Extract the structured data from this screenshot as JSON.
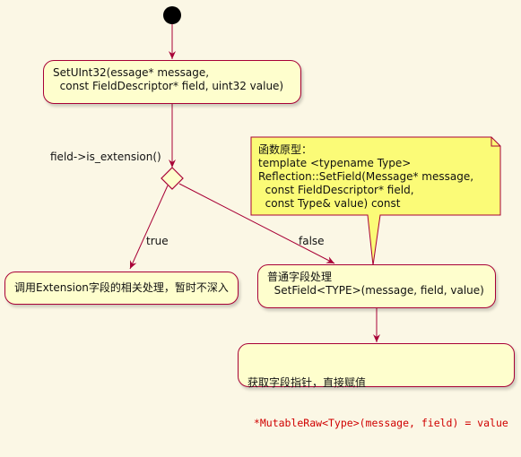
{
  "nodes": {
    "set_uint32": "SetUInt32(essage* message,\n  const FieldDescriptor* field, uint32 value)",
    "extension_process": "调用Extension字段的相关处理，暂时不深入",
    "normal_process": "普通字段处理\n  SetField<TYPE>(message, field, value)",
    "get_pointer_title": "获取字段指针，直接赋值",
    "get_pointer_code": " *MutableRaw<Type>(message, field) = value"
  },
  "decision": {
    "label": "field->is_extension()",
    "true_label": "true",
    "false_label": "false"
  },
  "note": {
    "text": "函数原型：\ntemplate <typename Type>\nReflection::SetField(Message* message,\n  const FieldDescriptor* field,\n  const Type& value) const"
  },
  "colors": {
    "background": "#fbf7e5",
    "node_fill": "#fefecd",
    "node_border": "#a80036",
    "note_fill": "#fbfb77",
    "code_text": "#d00000"
  }
}
